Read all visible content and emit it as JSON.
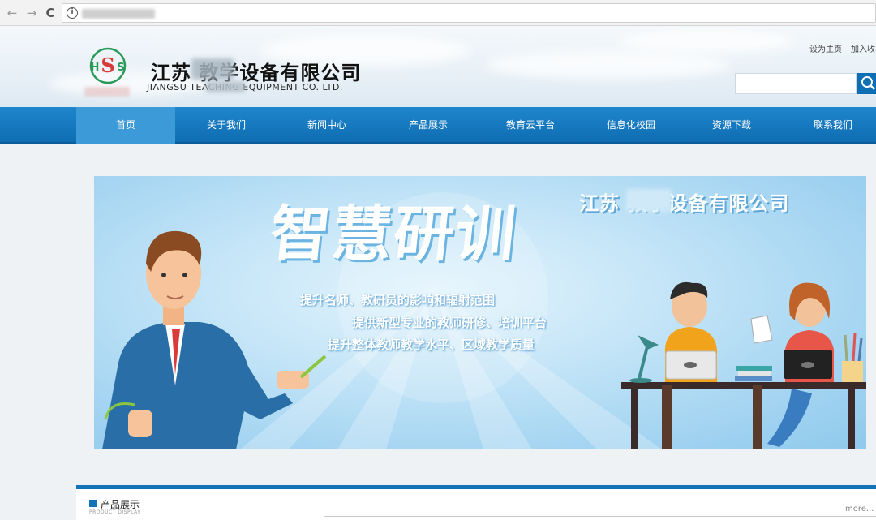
{
  "header": {
    "company_cn": "江苏      教学设备有限公司",
    "company_en": "JIANGSU              TEACHING EQUIPMENT CO. LTD.",
    "set_home": "设为主页",
    "add_fav": "加入收"
  },
  "nav": {
    "items": [
      {
        "label": "首页"
      },
      {
        "label": "关于我们"
      },
      {
        "label": "新闻中心"
      },
      {
        "label": "产品展示"
      },
      {
        "label": "教育云平台"
      },
      {
        "label": "信息化校园"
      },
      {
        "label": "资源下载"
      },
      {
        "label": "联系我们"
      }
    ],
    "active_index": 0
  },
  "banner": {
    "title": "智慧研训",
    "company": "江苏      教学设备有限公司",
    "lines": [
      "提升名师、教研员的影响和辐射范围",
      "提供新型专业的教师研修、培训平台",
      "提升整体教师教学水平、区域教学质量"
    ]
  },
  "product_section": {
    "title": "产品展示",
    "subtitle": "PRODUCT DISPLAY",
    "more": "more..."
  },
  "colors": {
    "nav_blue": "#0f6db3",
    "nav_active": "#3b9ad7",
    "banner_sky": "#a7d6f2",
    "section_bar": "#1273b8"
  },
  "icons": [
    "back-arrow-icon",
    "forward-arrow-icon",
    "reload-icon",
    "info-icon",
    "search-icon",
    "logo-icon",
    "section-arrow-icon"
  ]
}
